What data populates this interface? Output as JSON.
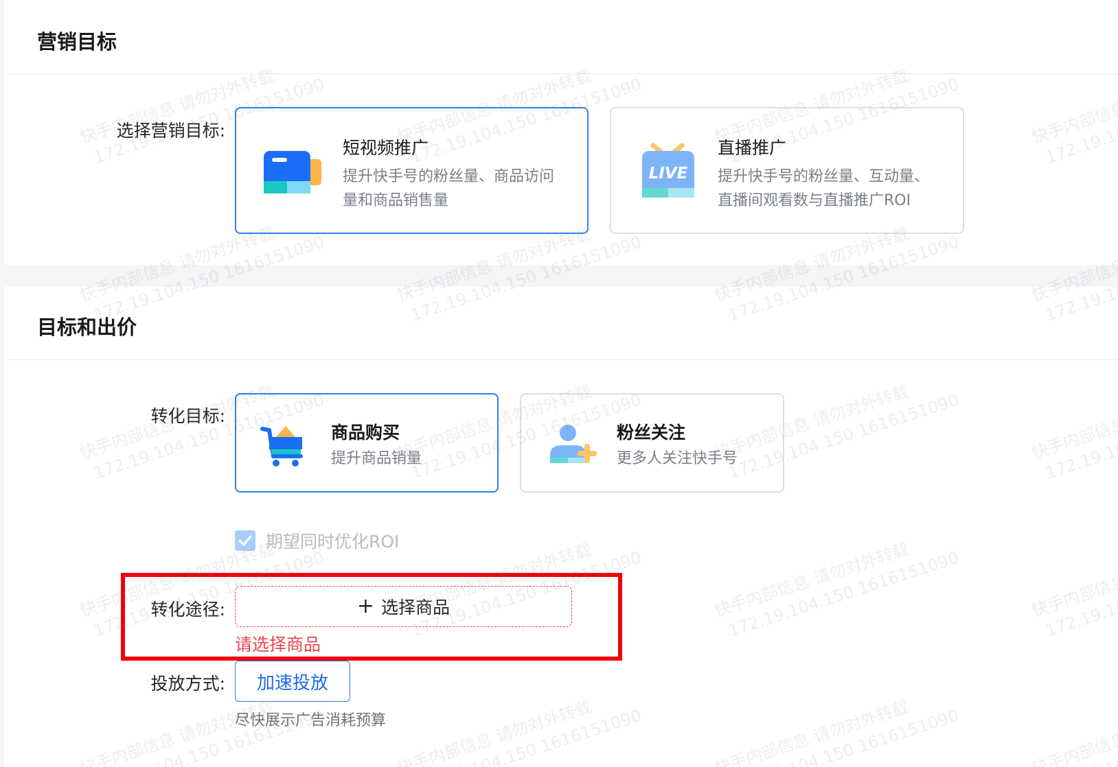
{
  "marketing": {
    "section_title": "营销目标",
    "field_label": "选择营销目标:",
    "options": [
      {
        "title": "短视频推广",
        "desc_line1": "提升快手号的粉丝量、商品访问",
        "desc_line2": "量和商品销售量",
        "icon": "video-camera-icon",
        "selected": true
      },
      {
        "title": "直播推广",
        "desc_line1": "提升快手号的粉丝量、互动量、",
        "desc_line2": "直播间观看数与直播推广ROI",
        "icon": "live-tv-icon",
        "badge": "LIVE",
        "selected": false
      }
    ]
  },
  "bidding": {
    "section_title": "目标和出价",
    "conversion_label": "转化目标:",
    "conversion_options": [
      {
        "title": "商品购买",
        "desc": "提升商品销量",
        "icon": "shopping-cart-icon",
        "selected": true
      },
      {
        "title": "粉丝关注",
        "desc": "更多人关注快手号",
        "icon": "add-follower-icon",
        "selected": false
      }
    ],
    "roi_checkbox_label": "期望同时优化ROI",
    "path_label": "转化途径:",
    "select_product_label": "选择商品",
    "select_product_plus": "+",
    "error_text": "请选择商品",
    "delivery_label": "投放方式:",
    "delivery_button": "加速投放",
    "delivery_hint": "尽快展示广告消耗预算"
  },
  "watermark": {
    "line1": "快手内部信息 请勿对外转载",
    "line2": "172.19.104.150 1616151090"
  },
  "colors": {
    "primary": "#2e7cf6",
    "error": "#f0454f",
    "highlight": "#f0000f",
    "checkbox_disabled": "#a7cff8"
  }
}
